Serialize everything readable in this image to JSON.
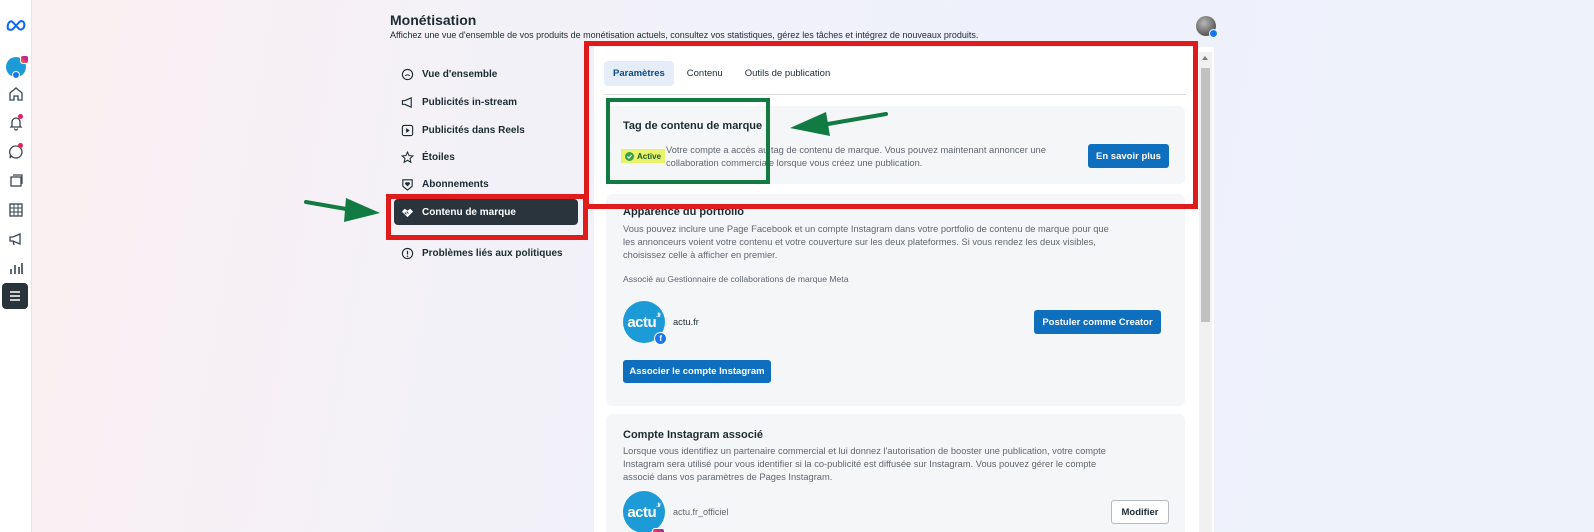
{
  "header": {
    "title": "Monétisation",
    "subtitle": "Affichez une vue d'ensemble de vos produits de monétisation actuels, consultez vos statistiques, gérez les tâches et intégrez de nouveaux produits."
  },
  "rail": {
    "icons": [
      "meta-logo-icon",
      "account-avatar",
      "home-icon",
      "notifications-icon",
      "messages-icon",
      "content-icon",
      "planner-icon",
      "ads-icon",
      "insights-icon",
      "menu-icon"
    ]
  },
  "nav": {
    "items": [
      {
        "label": "Vue d'ensemble",
        "icon": "overview-icon"
      },
      {
        "label": "Publicités in-stream",
        "icon": "megaphone-icon"
      },
      {
        "label": "Publicités dans Reels",
        "icon": "reels-icon"
      },
      {
        "label": "Étoiles",
        "icon": "star-icon"
      },
      {
        "label": "Abonnements",
        "icon": "heart-badge-icon"
      },
      {
        "label": "Contenu de marque",
        "icon": "handshake-icon"
      },
      {
        "label": "Problèmes liés aux politiques",
        "icon": "alert-circle-icon"
      }
    ],
    "selected": "Contenu de marque"
  },
  "tabs": [
    "Paramètres",
    "Contenu",
    "Outils de publication"
  ],
  "branded_tag": {
    "title": "Tag de contenu de marque",
    "status": "Active",
    "text_line1": "Votre compte a accès au tag de contenu de marque. Vous pouvez maintenant annoncer une",
    "text_line2": "collaboration commerciale lorsque vous créez une publication.",
    "button": "En savoir plus"
  },
  "portfolio": {
    "title": "Apparence du portfolio",
    "text_line1": "Vous pouvez inclure une Page Facebook et un compte Instagram dans votre portfolio de contenu de marque pour que",
    "text_line2": "les annonceurs voient votre contenu et votre couverture sur les deux plateformes. Si vous rendez les deux visibles,",
    "text_line3": "choisissez celle à afficher en premier.",
    "associated": "Associé au Gestionnaire de collaborations de marque Meta",
    "page_name": "actu.fr",
    "apply_button": "Postuler comme Creator",
    "link_instagram_button": "Associer le compte Instagram"
  },
  "instagram": {
    "title": "Compte Instagram associé",
    "text_line1": "Lorsque vous identifiez un partenaire commercial et lui donnez l'autorisation de booster une publication, votre compte",
    "text_line2": "Instagram sera utilisé pour vous identifier si la co-publicité est diffusée sur Instagram. Vous pouvez gérer le compte",
    "text_line3": "associé dans vos paramètres de Pages Instagram.",
    "account_name": "actu.fr_officiel",
    "edit_button": "Modifier"
  },
  "logo_text": {
    "main": "actu",
    "suffix": ".fr",
    "fb_glyph": "f"
  },
  "colors": {
    "accent_blue": "#0f6fbf",
    "selected_nav": "#2a343d",
    "annotation_red": "#e01b1b",
    "annotation_green": "#127a43",
    "highlight_yellow": "#e8f36a"
  }
}
